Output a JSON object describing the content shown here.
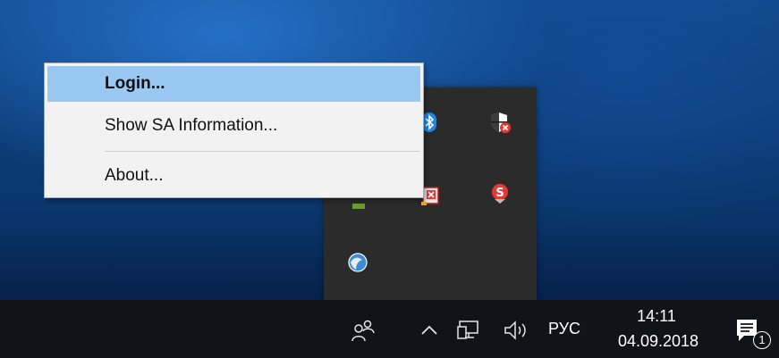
{
  "context_menu": {
    "items": [
      {
        "label": "Login...",
        "highlighted": true
      },
      {
        "label": "Show SA Information...",
        "highlighted": false
      },
      {
        "label": "About...",
        "highlighted": false
      }
    ]
  },
  "tray_flyout": {
    "icons": [
      "bluetooth-icon",
      "security-shield-icon",
      "app-icon",
      "sa-token-icon",
      "sa-s-icon",
      "network-globe-icon"
    ]
  },
  "taskbar": {
    "people_icon": "people-icon",
    "show_hidden_icon": "chevron-up-icon",
    "network_icon": "network-icon",
    "volume_icon": "volume-icon",
    "language": "РУС",
    "time": "14:11",
    "date": "04.09.2018",
    "notifications_icon": "action-center-icon",
    "notification_count": "1"
  },
  "colors": {
    "menu_highlight": "#99c9f2",
    "taskbar_bg": "#101317",
    "flyout_bg": "#2b2b2b"
  }
}
